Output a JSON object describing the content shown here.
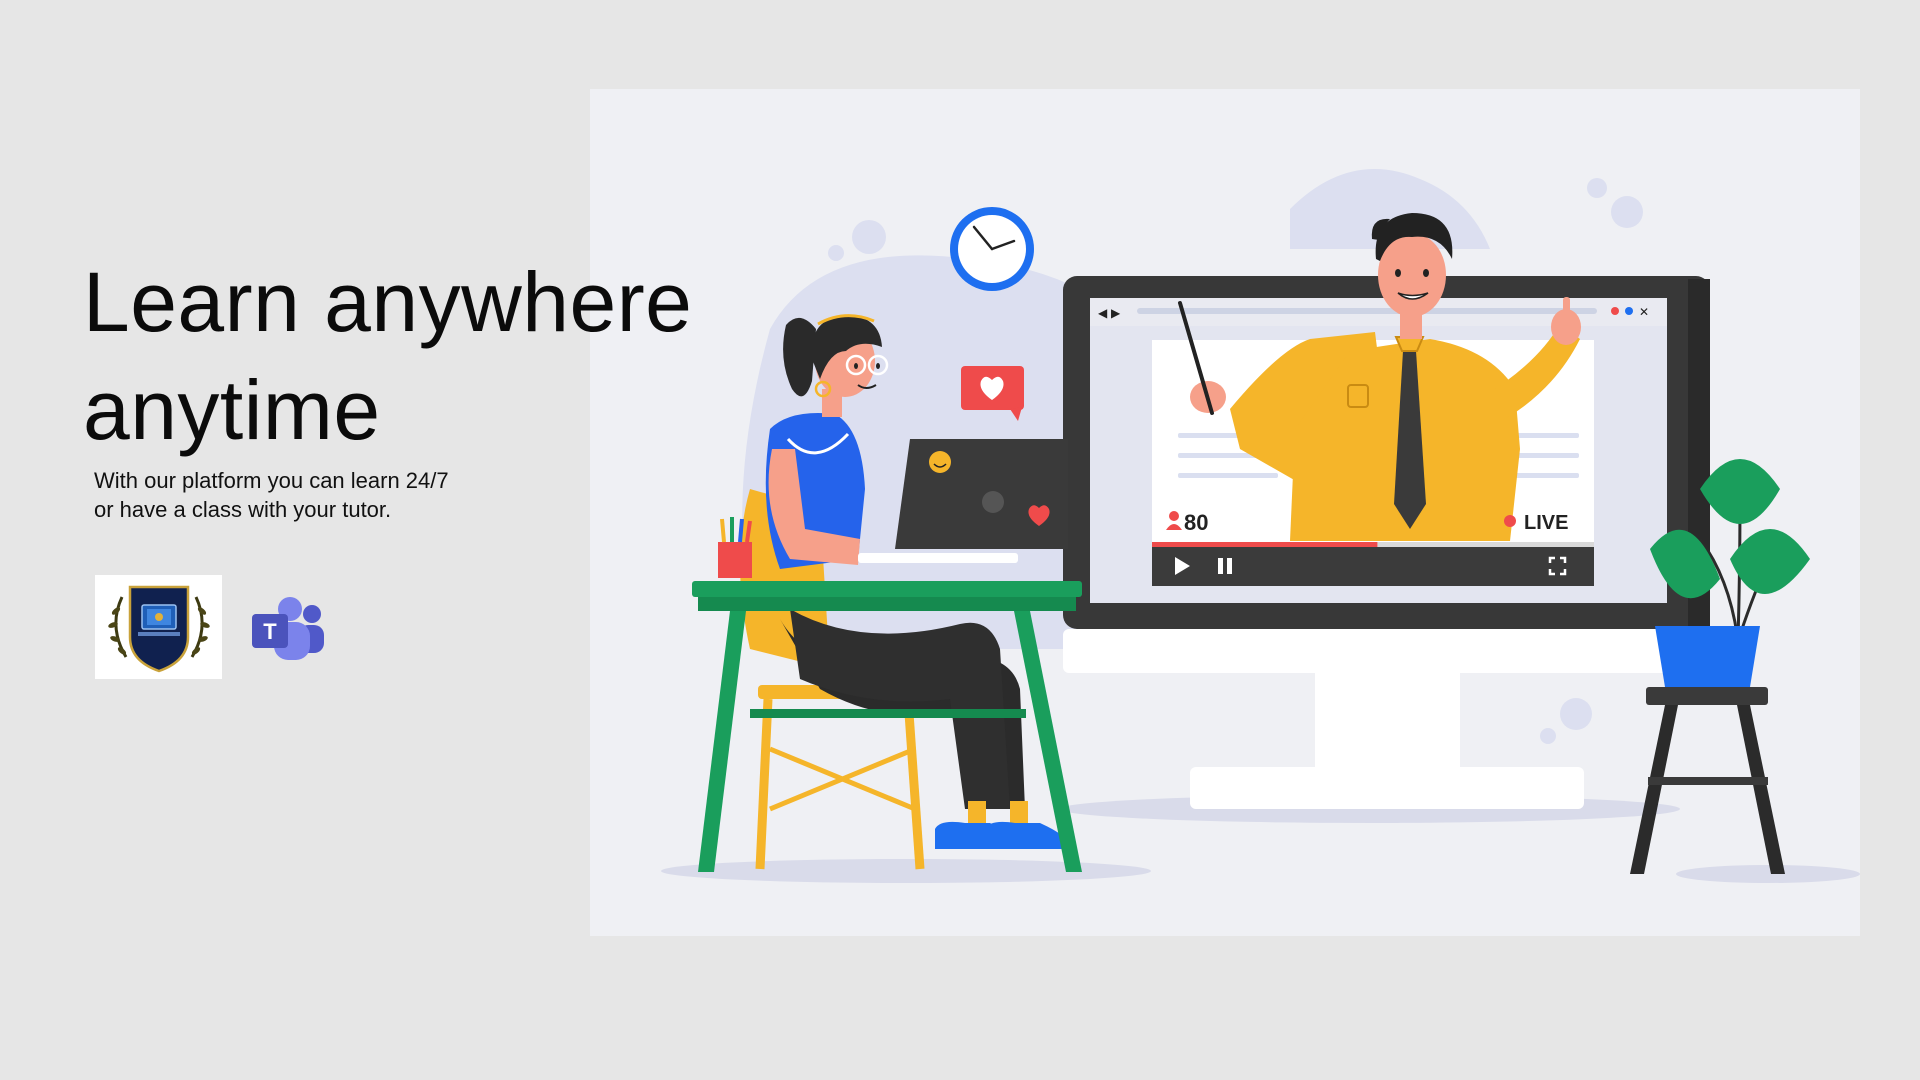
{
  "hero": {
    "title_line1": "Learn anywhere",
    "title_line2": "anytime",
    "subtitle_line1": "With our platform you can learn 24/7",
    "subtitle_line2": "or have a class with your tutor."
  },
  "logos": {
    "school": "school-crest-logo",
    "teams": "microsoft-teams-logo",
    "teams_letter": "T"
  },
  "video_player": {
    "viewer_count": "80",
    "live_label": "LIVE",
    "progress": 0.51
  },
  "colors": {
    "background": "#e6e6e6",
    "illustration_bg": "#eff0f4",
    "accent_red": "#ef4b4b",
    "desk_green": "#1a9e5c",
    "teacher_shirt": "#f5b52a",
    "student_top": "#2563eb",
    "teams_purple": "#5059c9"
  }
}
